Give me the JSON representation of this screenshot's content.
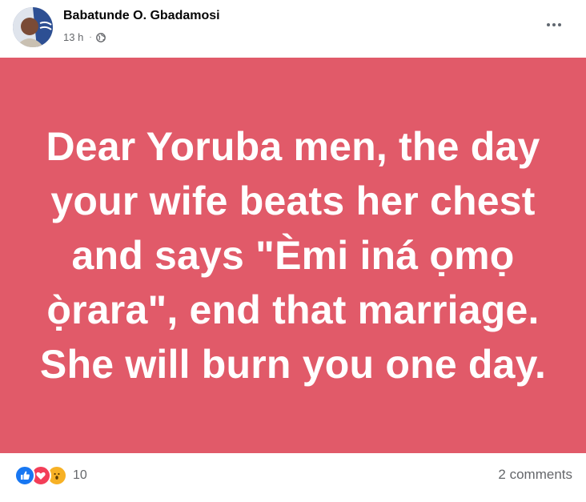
{
  "post": {
    "author": "Babatunde O. Gbadamosi",
    "timestamp": "13 h",
    "separator": "·",
    "privacy_icon": "globe-icon",
    "more_icon": "more-options-icon",
    "card_background": "#e15a69",
    "card_text": "Dear Yoruba men, the day your wife beats her chest and says \"Èmi iná ọmọ ọ̀rara\", end that marriage. She will burn you one day.",
    "reactions": {
      "icons": [
        "like-icon",
        "love-icon",
        "wow-icon"
      ],
      "count": "10"
    },
    "comments_label": "2 comments"
  }
}
